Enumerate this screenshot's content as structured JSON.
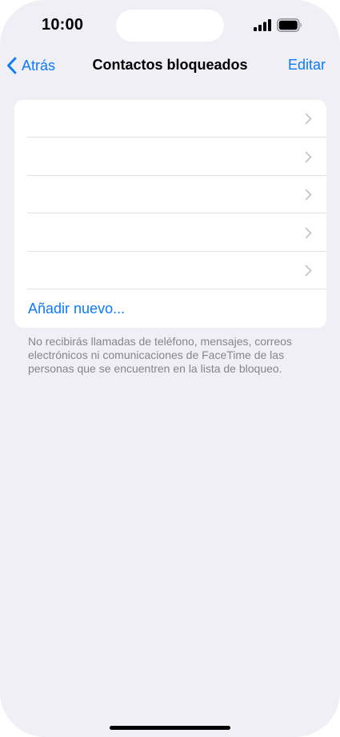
{
  "status_bar": {
    "time": "10:00",
    "signal_icon": "cellular-signal-icon",
    "battery_icon": "battery-full-icon"
  },
  "nav": {
    "back_label": "Atrás",
    "back_icon": "chevron-left-icon",
    "title": "Contactos bloqueados",
    "edit_label": "Editar"
  },
  "blocked_list": {
    "items": [
      {
        "label": ""
      },
      {
        "label": ""
      },
      {
        "label": ""
      },
      {
        "label": ""
      },
      {
        "label": ""
      }
    ],
    "add_label": "Añadir nuevo...",
    "footer": "No recibirás llamadas de teléfono, mensajes, correos electrónicos ni comunicaciones de FaceTime de las personas que se encuentren en la lista de bloqueo."
  },
  "colors": {
    "accent": "#0a7aff",
    "background": "#f0eff6",
    "card": "#ffffff",
    "secondary_text": "#85858b"
  }
}
